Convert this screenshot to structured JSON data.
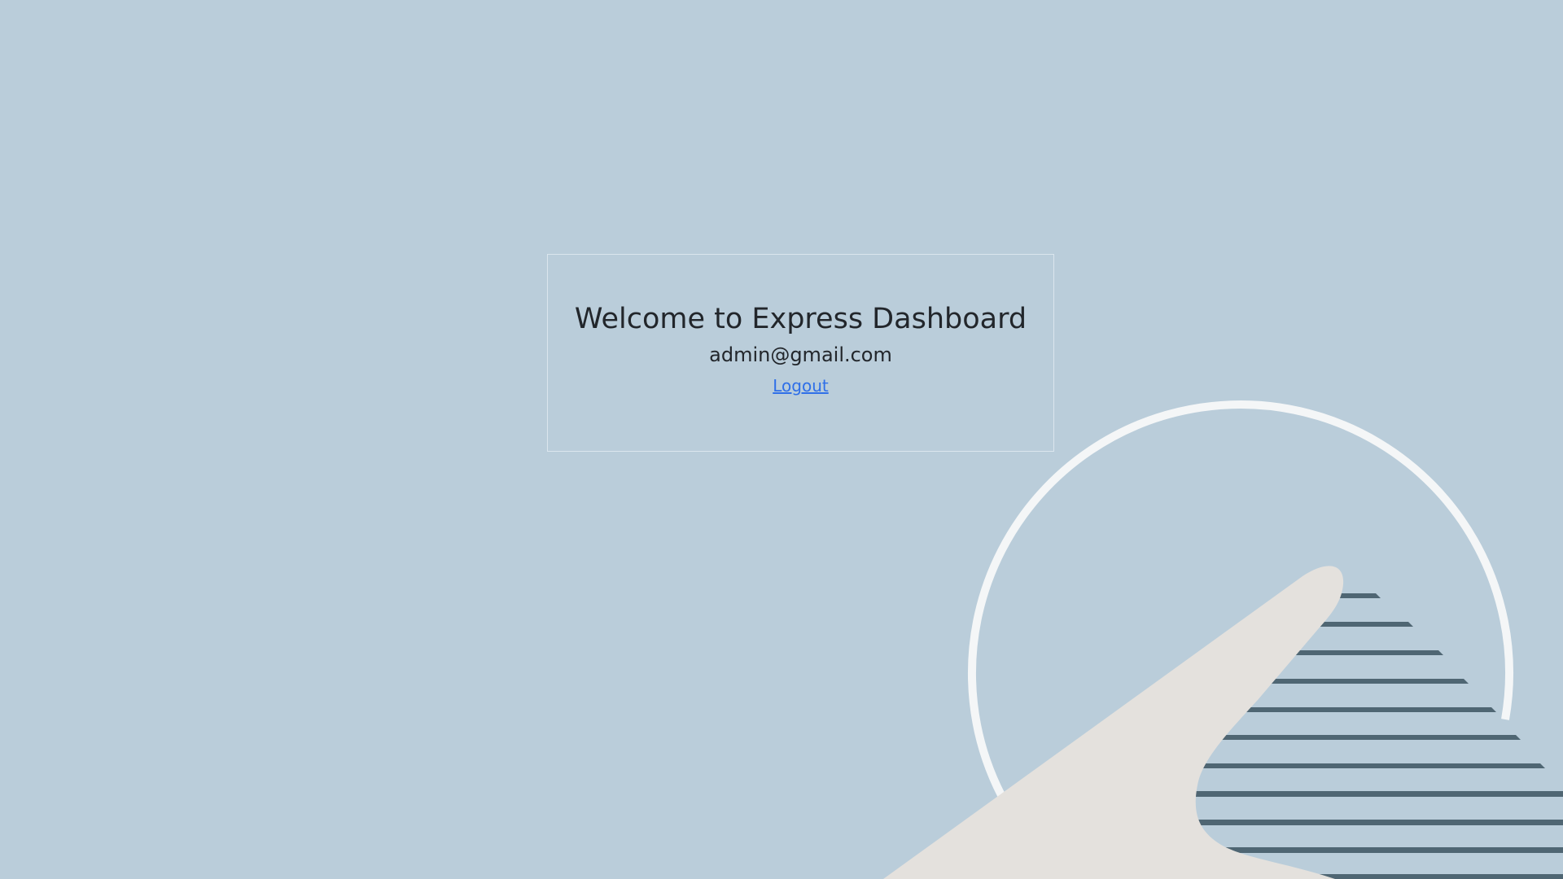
{
  "dashboard": {
    "title": "Welcome to Express Dashboard",
    "email": "admin@gmail.com",
    "logout_label": "Logout"
  },
  "colors": {
    "background": "#bacdda",
    "card_border": "#dbe6ee",
    "text": "#22262b",
    "link": "#2f6fe8",
    "circle_outline": "#f4f6f7",
    "stripes": "#4f6673",
    "hand": "#e4e1dd"
  },
  "icons": {
    "illustration": "pointing-hand-illustration"
  }
}
